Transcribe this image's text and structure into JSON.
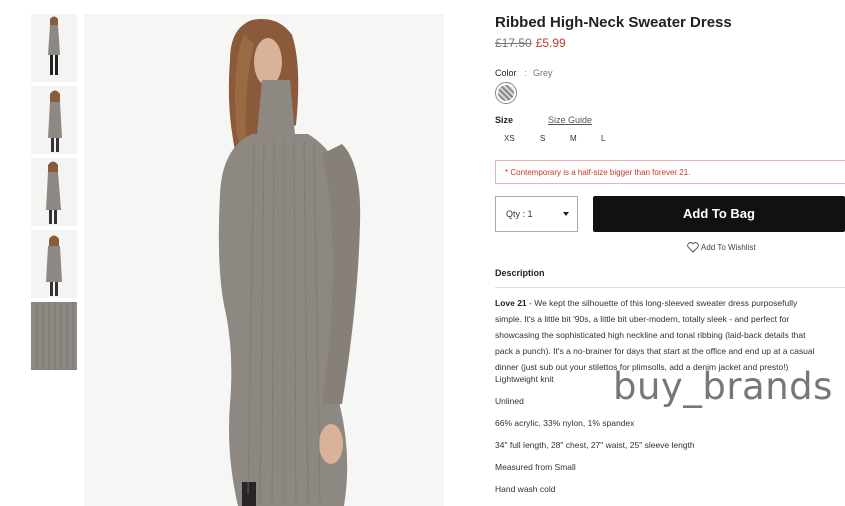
{
  "product": {
    "title": "Ribbed High-Neck Sweater Dress",
    "old_price": "£17.50",
    "new_price": "£5.99"
  },
  "color": {
    "label": "Color",
    "separator": ":",
    "value": "Grey"
  },
  "size": {
    "label": "Size",
    "guide_label": "Size Guide",
    "options": [
      "XS",
      "S",
      "M",
      "L"
    ]
  },
  "notice": "* Contemporary is a half-size bigger than forever 21.",
  "quantity": {
    "label": "Qty : 1"
  },
  "actions": {
    "add_to_bag": "Add To Bag",
    "wishlist": "Add To Wishlist"
  },
  "description": {
    "heading": "Description",
    "lead_brand": "Love 21",
    "lines": [
      " - We kept the silhouette of this long-sleeved sweater dress purposefully",
      "simple. It's a little bit '90s, a little bit uber-modern, totally sleek - and perfect for",
      "showcasing the sophisticated high neckline and tonal ribbing (laid-back details that",
      "pack a punch). It's a no-brainer for days that start at the office and end up at a casual",
      "dinner (just sub out your stilettos for plimsolls, add a denim jacket and presto!)"
    ],
    "details": [
      "Lightweight knit",
      "Unlined",
      "66% acrylic, 33% nylon, 1% spandex",
      "34\" full length, 28\" chest, 27\" waist, 25\" sleeve length",
      "Measured from Small",
      "Hand wash cold"
    ]
  },
  "watermark": "buy_brands",
  "colors": {
    "sale_red": "#c0392b",
    "button_black": "#111111",
    "dress_grey": "#8e8883"
  }
}
